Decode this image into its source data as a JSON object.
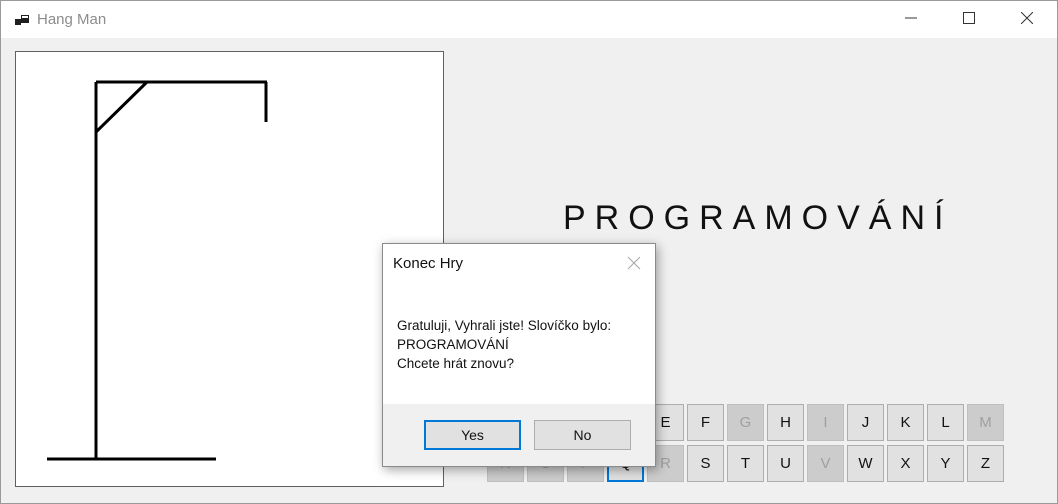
{
  "window": {
    "title": "Hang Man",
    "icon": "app-icon"
  },
  "gallows": {
    "stage": 1
  },
  "word": "PROGRAMOVÁNÍ",
  "keys_row1": [
    {
      "label": "E",
      "state": "enabled"
    },
    {
      "label": "F",
      "state": "enabled"
    },
    {
      "label": "G",
      "state": "disabled"
    },
    {
      "label": "H",
      "state": "enabled"
    },
    {
      "label": "I",
      "state": "disabled"
    },
    {
      "label": "J",
      "state": "enabled"
    },
    {
      "label": "K",
      "state": "enabled"
    },
    {
      "label": "L",
      "state": "enabled"
    },
    {
      "label": "M",
      "state": "disabled"
    }
  ],
  "keys_row2": [
    {
      "label": "N",
      "state": "disabled"
    },
    {
      "label": "O",
      "state": "disabled"
    },
    {
      "label": "P",
      "state": "disabled"
    },
    {
      "label": "Q",
      "state": "focused"
    },
    {
      "label": "R",
      "state": "disabled"
    },
    {
      "label": "S",
      "state": "enabled"
    },
    {
      "label": "T",
      "state": "enabled"
    },
    {
      "label": "U",
      "state": "enabled"
    },
    {
      "label": "V",
      "state": "disabled"
    },
    {
      "label": "W",
      "state": "enabled"
    },
    {
      "label": "X",
      "state": "enabled"
    },
    {
      "label": "Y",
      "state": "enabled"
    },
    {
      "label": "Z",
      "state": "enabled"
    }
  ],
  "dialog": {
    "title": "Konec Hry",
    "message_line1": "Gratuluji, Vyhrali jste! Slovíčko bylo:",
    "message_line2": "PROGRAMOVÁNÍ",
    "message_line3": "Chcete hrát znovu?",
    "yes_label": "Yes",
    "no_label": "No"
  },
  "colors": {
    "accent": "#0078d7",
    "disabled_key": "#cccccc",
    "key": "#e1e1e1"
  }
}
